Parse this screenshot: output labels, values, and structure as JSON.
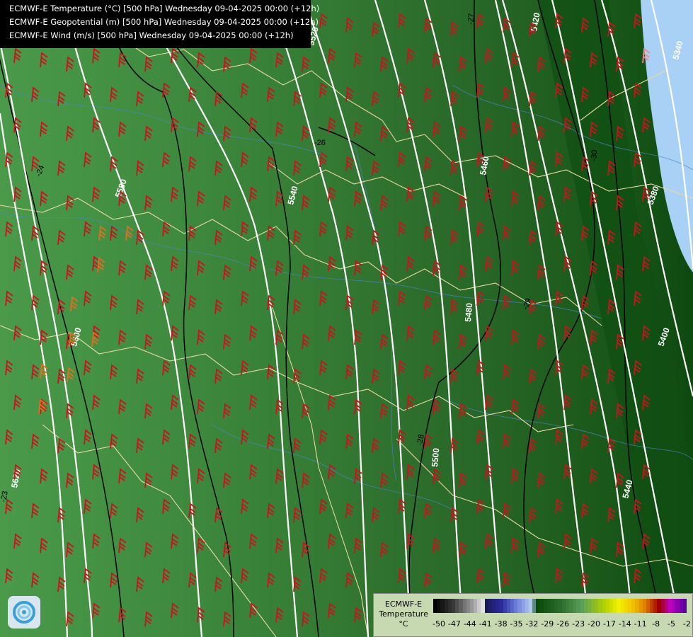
{
  "titles": [
    "ECMWF-E Temperature (°C) [500 hPa] Wednesday 09-04-2025 00:00 (+12h)",
    "ECMWF-E Geopotential (m) [500 hPa] Wednesday 09-04-2025 00:00 (+12h)",
    "ECMWF-E Wind (m/s) [500 hPa] Wednesday 09-04-2025 00:00 (+12h)"
  ],
  "legend": {
    "title_line1": "ECMWF-E",
    "title_line2": "Temperature",
    "unit": "°C",
    "ticks": [
      "-50",
      "-47",
      "-44",
      "-41",
      "-38",
      "-35",
      "-32",
      "-29",
      "-26",
      "-23",
      "-20",
      "-17",
      "-14",
      "-11",
      "-8",
      "-5",
      "-2"
    ]
  },
  "geopotential_labels": [
    "5620",
    "5600",
    "5580",
    "5540",
    "5520",
    "5500",
    "5480",
    "5460",
    "5440",
    "5420",
    "5400",
    "5380",
    "5340"
  ],
  "temperature_labels": [
    "-23",
    "-24",
    "-26",
    "-27",
    "-28",
    "-29",
    "-30"
  ],
  "colors": {
    "temp_-23": "#3a8a3a",
    "temp_-26": "#2e742e",
    "temp_-29": "#1a5a1a",
    "cold_band": "#a9d1f5",
    "geopotential_contour": "#ffffff",
    "temperature_contour": "#000000",
    "wind_barb": "#c8141e",
    "wind_barb_strong": "#e07020",
    "border": "#e8d9a0",
    "river": "#4a86c8"
  },
  "icons": {
    "logo": "ecmwf-logo-icon"
  }
}
